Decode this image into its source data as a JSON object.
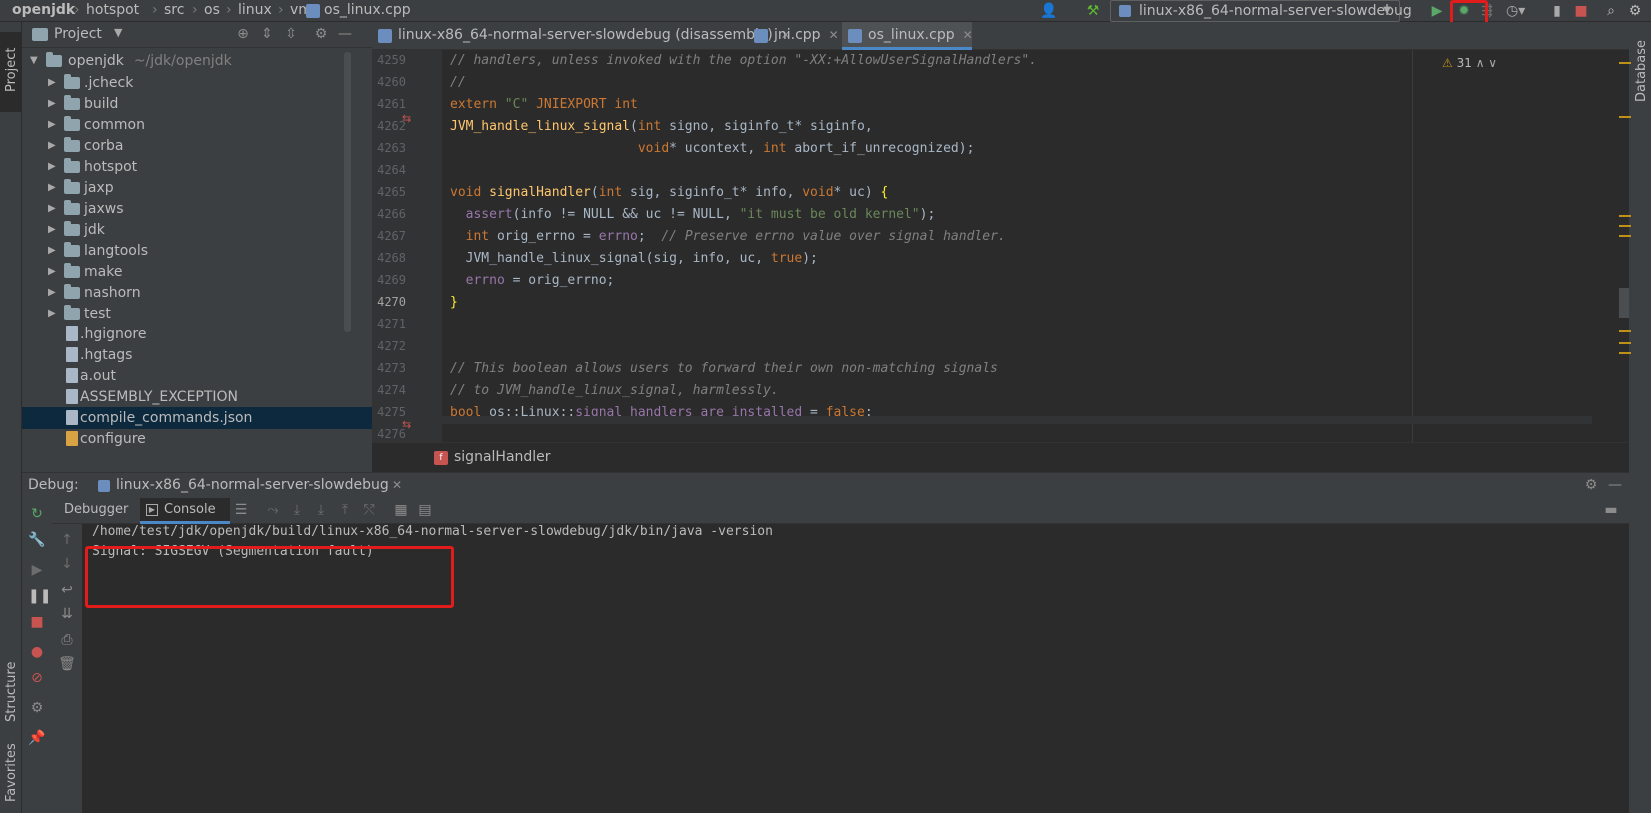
{
  "breadcrumb": [
    "openjdk",
    "hotspot",
    "src",
    "os",
    "linux",
    "vm",
    "os_linux.cpp"
  ],
  "toolbar": {
    "run_config": "linux-x86_64-normal-server-slowdebug"
  },
  "left_strip": {
    "project": "Project",
    "structure": "Structure",
    "favorites": "Favorites"
  },
  "right_strip": {
    "database": "Database"
  },
  "project_panel": {
    "title": "Project",
    "root": {
      "name": "openjdk",
      "path": "~/jdk/openjdk"
    },
    "folders": [
      "jcheck",
      "build",
      "common",
      "corba",
      "hotspot",
      "jaxp",
      "jaxws",
      "jdk",
      "langtools",
      "make",
      "nashorn",
      "test"
    ],
    "folder_labels": [
      ".jcheck",
      "build",
      "common",
      "corba",
      "hotspot",
      "jaxp",
      "jaxws",
      "jdk",
      "langtools",
      "make",
      "nashorn",
      "test"
    ],
    "files": [
      ".hgignore",
      ".hgtags",
      "a.out",
      "ASSEMBLY_EXCEPTION",
      "compile_commands.json",
      "configure"
    ],
    "selected_file": "compile_commands.json"
  },
  "editor": {
    "tabs": [
      {
        "label": "linux-x86_64-normal-server-slowdebug (disassembly)"
      },
      {
        "label": "jni.cpp"
      },
      {
        "label": "os_linux.cpp"
      }
    ],
    "warnings_count": "31",
    "line_numbers": [
      "4259",
      "4260",
      "4261",
      "4262",
      "4263",
      "4264",
      "4265",
      "4266",
      "4267",
      "4268",
      "4269",
      "4270",
      "4271",
      "4272",
      "4273",
      "4274",
      "4275",
      "4276"
    ],
    "current_line": "4270",
    "breadcrumb_function": "signalHandler"
  },
  "debug": {
    "label": "Debug:",
    "session": "linux-x86_64-normal-server-slowdebug",
    "tabs": {
      "debugger": "Debugger",
      "console": "Console"
    },
    "console_lines": [
      "/home/test/jdk/openjdk/build/linux-x86_64-normal-server-slowdebug/jdk/bin/java -version",
      "Signal: SIGSEGV (Segmentation fault)"
    ]
  }
}
